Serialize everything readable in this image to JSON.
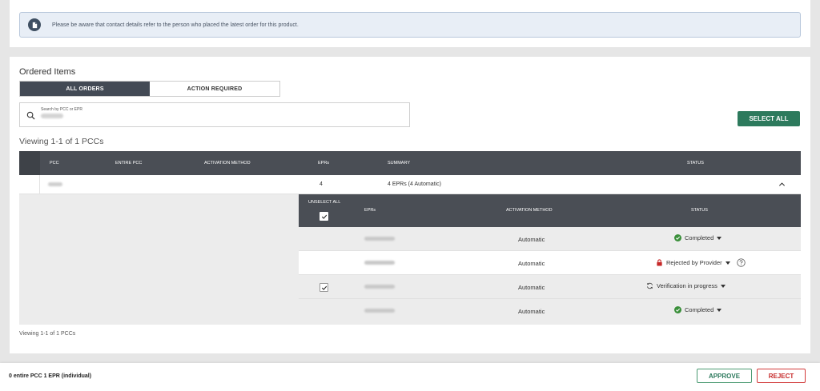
{
  "notice": {
    "icon": "document-info-icon",
    "text": "Please be aware that contact details refer to the person who placed the latest order for this product."
  },
  "section_title": "Ordered Items",
  "tabs": [
    {
      "label": "ALL ORDERS",
      "active": true
    },
    {
      "label": "ACTION REQUIRED",
      "active": false
    }
  ],
  "search": {
    "placeholder": "Search by PCC or EPR",
    "icon": "search-icon"
  },
  "select_all_label": "SELECT ALL",
  "viewing_text": "Viewing 1-1 of 1 PCCs",
  "table": {
    "headers": {
      "pcc": "PCC",
      "entire_pcc": "ENTIRE PCC",
      "activation_method": "ACTIVATION METHOD",
      "eprs": "EPRs",
      "summary": "SUMMARY",
      "status": "STATUS"
    },
    "row": {
      "eprs": "4",
      "summary": "4 EPRs (4 Automatic)",
      "expanded": true
    }
  },
  "subtable": {
    "headers": {
      "unselect_all": "UNSELECT ALL",
      "eprs": "EPRs",
      "activation_method": "ACTIVATION METHOD",
      "status": "STATUS"
    },
    "rows": [
      {
        "method": "Automatic",
        "status": "Completed",
        "status_icon": "check-circle-icon",
        "checked": false,
        "has_checkbox": false,
        "has_help": false
      },
      {
        "method": "Automatic",
        "status": "Rejected by Provider",
        "status_icon": "lock-icon",
        "checked": false,
        "has_checkbox": false,
        "has_help": true
      },
      {
        "method": "Automatic",
        "status": "Verification in progress",
        "status_icon": "sync-icon",
        "checked": true,
        "has_checkbox": true,
        "has_help": false
      },
      {
        "method": "Automatic",
        "status": "Completed",
        "status_icon": "check-circle-icon",
        "checked": false,
        "has_checkbox": false,
        "has_help": false
      }
    ]
  },
  "viewing_bottom": "Viewing 1-1 of 1 PCCs",
  "footer": {
    "selection": "0 entire PCC 1 EPR (individual)",
    "approve_label": "APPROVE",
    "reject_label": "REJECT"
  },
  "colors": {
    "accent_green": "#2d7a5d",
    "reject_red": "#c62828",
    "header_dark": "#4a4e55",
    "success": "#3a8f3a"
  }
}
